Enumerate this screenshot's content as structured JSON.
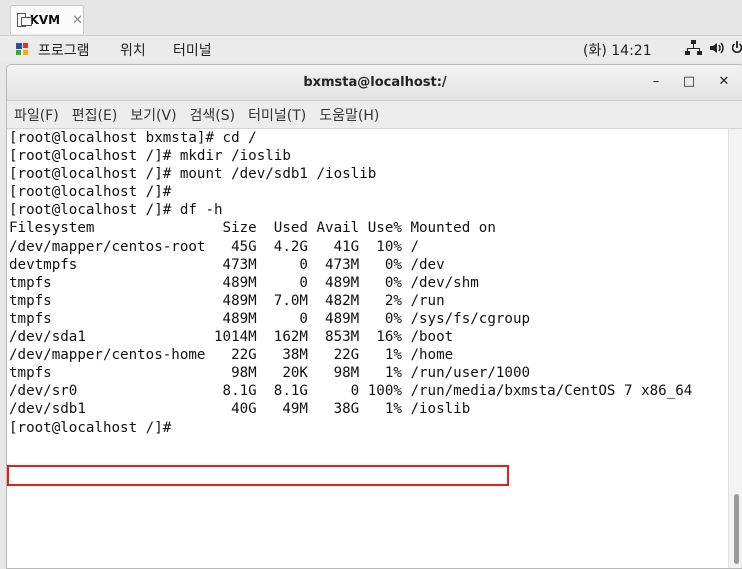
{
  "vm_tab": {
    "title": "KVM",
    "close": "✕"
  },
  "topbar": {
    "apps": "프로그램",
    "places": "위치",
    "terminal": "터미널",
    "clock": "(화) 14:21"
  },
  "window": {
    "title": "bxmsta@localhost:/",
    "minimize": "–",
    "maximize": "□",
    "close": "✕"
  },
  "menu": [
    "파일(F)",
    "편집(E)",
    "보기(V)",
    "검색(S)",
    "터미널(T)",
    "도움말(H)"
  ],
  "terminal": {
    "lines": [
      "[root@localhost bxmsta]# cd /",
      "[root@localhost /]# mkdir /ioslib",
      "[root@localhost /]# mount /dev/sdb1 /ioslib",
      "[root@localhost /]#",
      "[root@localhost /]# df -h",
      "Filesystem               Size  Used Avail Use% Mounted on",
      "/dev/mapper/centos-root   45G  4.2G   41G  10% /",
      "devtmpfs                 473M     0  473M   0% /dev",
      "tmpfs                    489M     0  489M   0% /dev/shm",
      "tmpfs                    489M  7.0M  482M   2% /run",
      "tmpfs                    489M     0  489M   0% /sys/fs/cgroup",
      "/dev/sda1               1014M  162M  853M  16% /boot",
      "/dev/mapper/centos-home   22G   38M   22G   1% /home",
      "tmpfs                     98M   20K   98M   1% /run/user/1000",
      "/dev/sr0                 8.1G  8.1G     0 100% /run/media/bxmsta/CentOS 7 x86_64",
      "/dev/sdb1                 40G   49M   38G   1% /ioslib",
      "[root@localhost /]#"
    ]
  }
}
